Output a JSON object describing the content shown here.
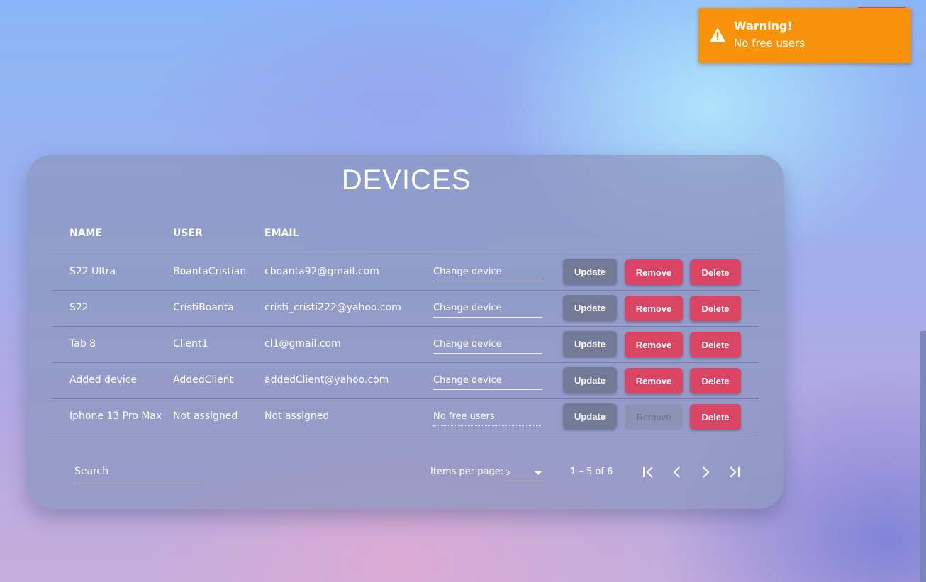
{
  "toast": {
    "title": "Warning!",
    "message": "No free users",
    "icon": "warning-triangle-icon",
    "color": "#f7930a"
  },
  "card": {
    "title": "DEVICES"
  },
  "table": {
    "headers": [
      "NAME",
      "USER",
      "EMAIL"
    ],
    "rows": [
      {
        "name": "S22 Ultra",
        "user": "BoantaCristian",
        "email": "cboanta92@gmail.com",
        "select": "Change device",
        "update": "Update",
        "remove": "Remove",
        "delete": "Delete"
      },
      {
        "name": "S22",
        "user": "CristiBoanta",
        "email": "cristi_cristi222@yahoo.com",
        "select": "Change device",
        "update": "Update",
        "remove": "Remove",
        "delete": "Delete"
      },
      {
        "name": "Tab 8",
        "user": "Client1",
        "email": "cl1@gmail.com",
        "select": "Change device",
        "update": "Update",
        "remove": "Remove",
        "delete": "Delete"
      },
      {
        "name": "Added device",
        "user": "AddedClient",
        "email": "addedClient@yahoo.com",
        "select": "Change device",
        "update": "Update",
        "remove": "Remove",
        "delete": "Delete"
      },
      {
        "name": "Iphone 13 Pro Max",
        "user": "Not assigned",
        "email": "Not assigned",
        "select": "No free users",
        "update": "Update",
        "remove": "Remove",
        "delete": "Delete"
      }
    ]
  },
  "footer": {
    "search_placeholder": "Search",
    "items_per_page_label": "Items per page:",
    "items_per_page_value": "5",
    "range": "1 – 5 of 6"
  },
  "colors": {
    "update": "#737a97",
    "danger": "#d94565",
    "warning": "#f7930a"
  }
}
